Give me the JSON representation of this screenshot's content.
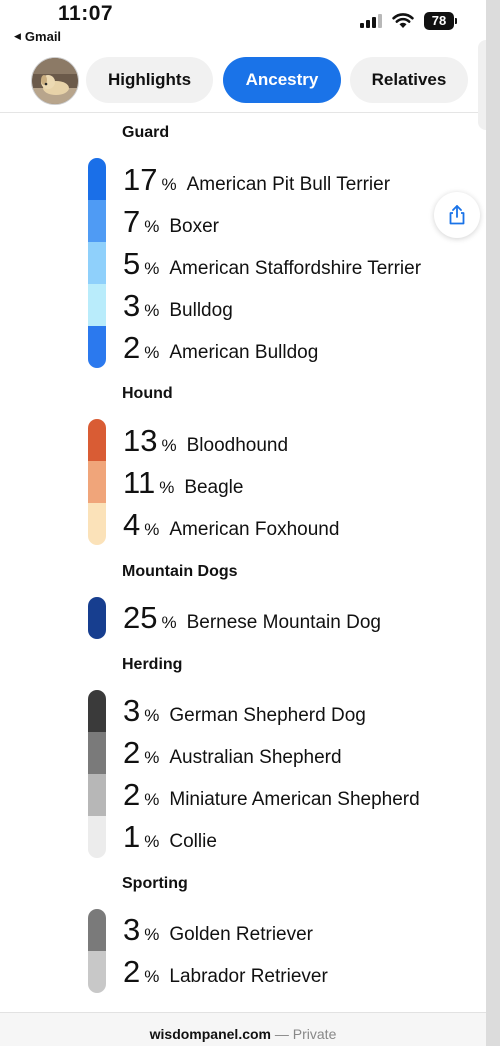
{
  "status_bar": {
    "time": "11:07",
    "back_app": "Gmail",
    "battery": "78",
    "icons": [
      "signal-icon",
      "wifi-icon",
      "battery-icon"
    ]
  },
  "tabs": [
    {
      "label": "Highlights",
      "active": false
    },
    {
      "label": "Ancestry",
      "active": true
    },
    {
      "label": "Relatives",
      "active": false
    }
  ],
  "groups": [
    {
      "title": "Guard",
      "breeds": [
        {
          "pct": "17",
          "unit": "%",
          "name": "American Pit Bull Terrier",
          "color": "#1a6fe8"
        },
        {
          "pct": "7",
          "unit": "%",
          "name": "Boxer",
          "color": "#4f9bf4"
        },
        {
          "pct": "5",
          "unit": "%",
          "name": "American Staffordshire Terrier",
          "color": "#8fd0fb"
        },
        {
          "pct": "3",
          "unit": "%",
          "name": "Bulldog",
          "color": "#b9ecfb"
        },
        {
          "pct": "2",
          "unit": "%",
          "name": "American Bulldog",
          "color": "#2b79ee"
        }
      ]
    },
    {
      "title": "Hound",
      "breeds": [
        {
          "pct": "13",
          "unit": "%",
          "name": "Bloodhound",
          "color": "#d95c34"
        },
        {
          "pct": "11",
          "unit": "%",
          "name": "Beagle",
          "color": "#f0a57a"
        },
        {
          "pct": "4",
          "unit": "%",
          "name": "American Foxhound",
          "color": "#fbe2b9"
        }
      ]
    },
    {
      "title": "Mountain Dogs",
      "breeds": [
        {
          "pct": "25",
          "unit": "%",
          "name": "Bernese Mountain Dog",
          "color": "#173e8f"
        }
      ]
    },
    {
      "title": "Herding",
      "breeds": [
        {
          "pct": "3",
          "unit": "%",
          "name": "German Shepherd Dog",
          "color": "#3a3a3a"
        },
        {
          "pct": "2",
          "unit": "%",
          "name": "Australian Shepherd",
          "color": "#7a7a7a"
        },
        {
          "pct": "2",
          "unit": "%",
          "name": "Miniature American Shepherd",
          "color": "#b7b7b7"
        },
        {
          "pct": "1",
          "unit": "%",
          "name": "Collie",
          "color": "#ececec"
        }
      ]
    },
    {
      "title": "Sporting",
      "breeds": [
        {
          "pct": "3",
          "unit": "%",
          "name": "Golden Retriever",
          "color": "#7a7a7a"
        },
        {
          "pct": "2",
          "unit": "%",
          "name": "Labrador Retriever",
          "color": "#c8c8c8"
        }
      ]
    }
  ],
  "footer": {
    "domain": "wisdompanel.com",
    "separator": " — ",
    "privacy": "Private"
  },
  "colors": {
    "accent": "#1a73e8"
  }
}
